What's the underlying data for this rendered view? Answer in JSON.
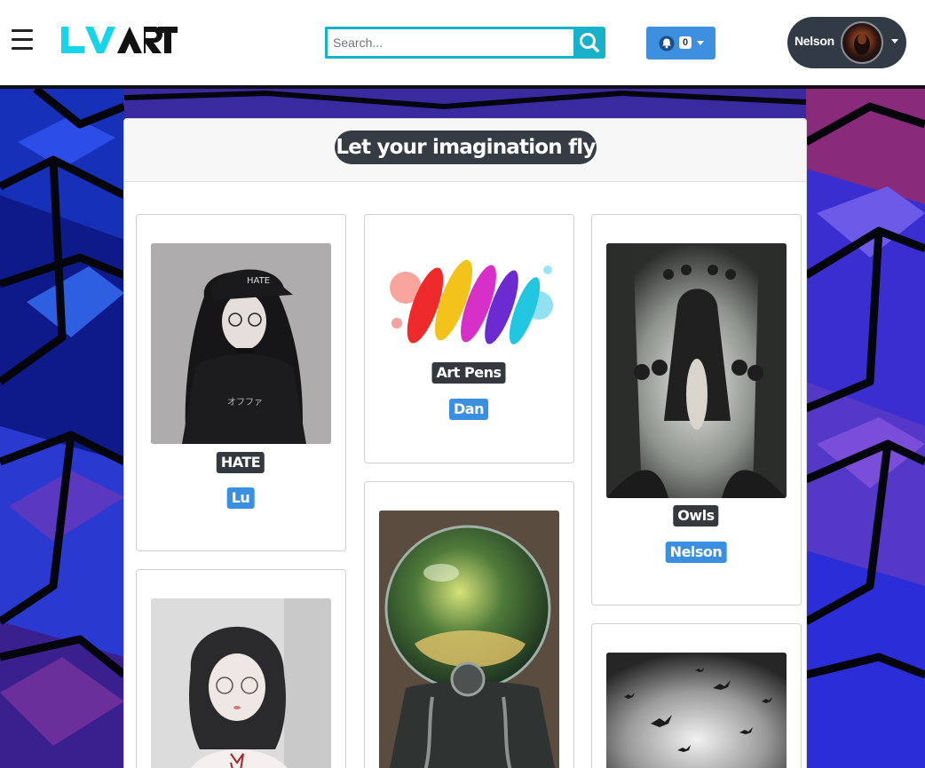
{
  "header": {
    "logo_text": "LVART",
    "search": {
      "placeholder": "Search...",
      "value": ""
    },
    "notifications": {
      "count": "0"
    },
    "user": {
      "name": "Nelson"
    }
  },
  "main": {
    "title": "Let your imagination fly",
    "artworks": [
      {
        "title": "HATE",
        "author": "Lu"
      },
      {
        "title": "Art Pens",
        "author": "Dan"
      },
      {
        "title": "Owls",
        "author": "Nelson"
      },
      {
        "title": "",
        "author": ""
      },
      {
        "title": "",
        "author": ""
      },
      {
        "title": "",
        "author": ""
      }
    ]
  },
  "colors": {
    "accent_teal": "#17b2c9",
    "accent_blue": "#3a8fe0",
    "dark_label": "#33393f",
    "title_pill": "#353c44"
  },
  "icons": [
    "menu-icon",
    "search-icon",
    "bell-icon",
    "chevron-down-icon"
  ]
}
